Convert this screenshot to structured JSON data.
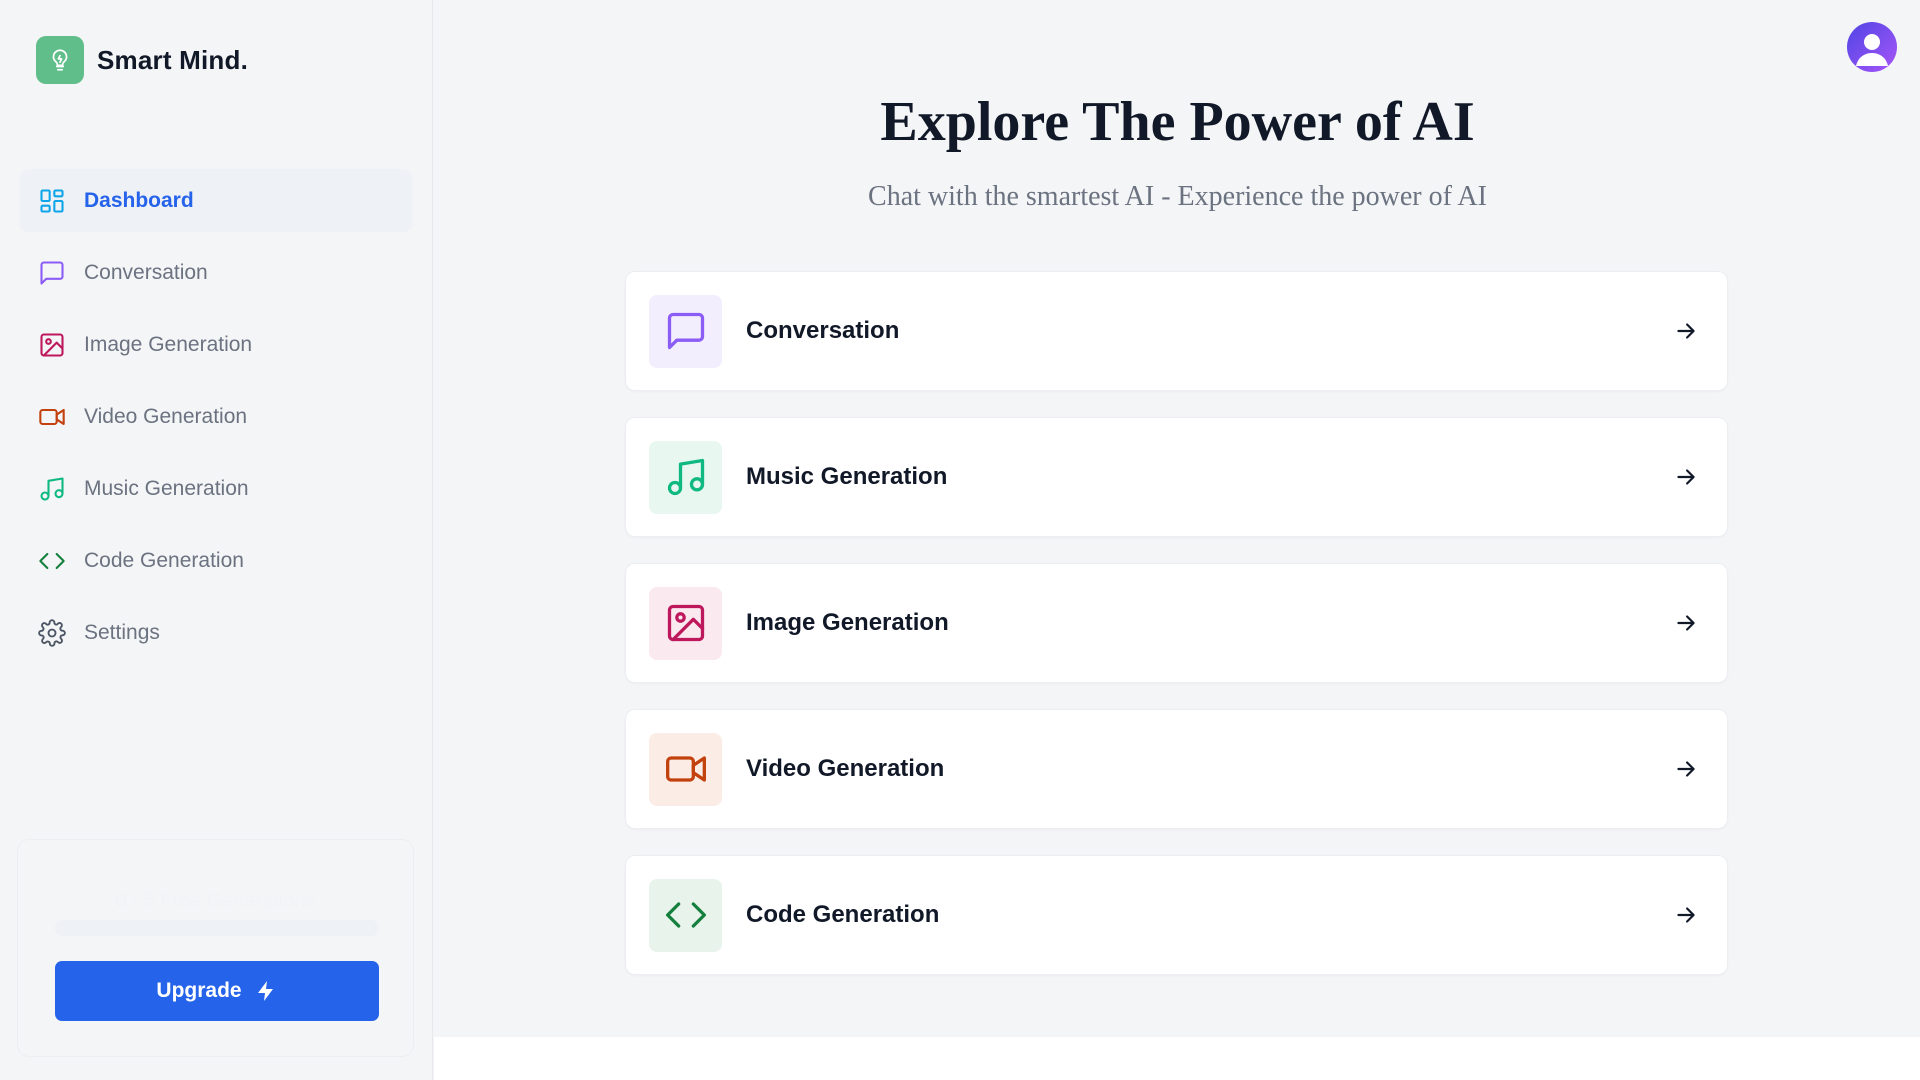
{
  "brand": {
    "name": "Smart Mind."
  },
  "sidebar": {
    "items": [
      {
        "label": "Dashboard",
        "icon": "dashboard-icon",
        "color": "#2563eb",
        "active": true
      },
      {
        "label": "Conversation",
        "icon": "chat-icon",
        "color": "#8b5cf6"
      },
      {
        "label": "Image Generation",
        "icon": "image-icon",
        "color": "#be185d"
      },
      {
        "label": "Video Generation",
        "icon": "video-icon",
        "color": "#c2410c"
      },
      {
        "label": "Music Generation",
        "icon": "music-icon",
        "color": "#10b981"
      },
      {
        "label": "Code Generation",
        "icon": "code-icon",
        "color": "#15803d"
      },
      {
        "label": "Settings",
        "icon": "gear-icon",
        "color": "#4b5563"
      }
    ],
    "usage": {
      "text": "0 / 5 Free Generations",
      "used": 0,
      "limit": 5
    },
    "upgrade_label": "Upgrade"
  },
  "main": {
    "title": "Explore The Power of AI",
    "subtitle": "Chat with the smartest AI - Experience the power of AI",
    "tools": [
      {
        "label": "Conversation",
        "icon": "chat-icon",
        "color": "#8b5cf6",
        "bg": "#f3eefe"
      },
      {
        "label": "Music Generation",
        "icon": "music-icon",
        "color": "#10b981",
        "bg": "#e8f8f1"
      },
      {
        "label": "Image Generation",
        "icon": "image-icon",
        "color": "#be185d",
        "bg": "#fbe9f0"
      },
      {
        "label": "Video Generation",
        "icon": "video-icon",
        "color": "#c2410c",
        "bg": "#fbede6"
      },
      {
        "label": "Code Generation",
        "icon": "code-icon",
        "color": "#15803d",
        "bg": "#e8f4eb"
      }
    ]
  },
  "colors": {
    "accent": "#2563eb",
    "brand": "#5fbe8a"
  }
}
